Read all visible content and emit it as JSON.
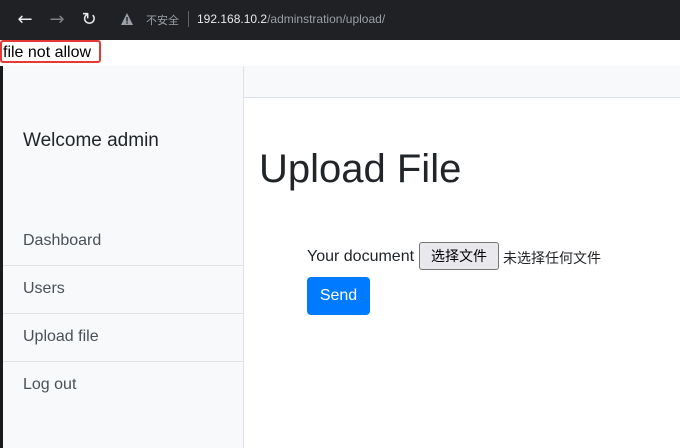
{
  "browser": {
    "insecure_label": "不安全",
    "url_host": "192.168.10.2",
    "url_path": "/adminstration/upload/",
    "icons": [
      "back-arrow-icon",
      "forward-arrow-icon",
      "reload-icon",
      "warning-icon"
    ]
  },
  "error": {
    "message": "file not allow"
  },
  "sidebar": {
    "welcome": "Welcome admin",
    "items": [
      {
        "label": "Dashboard"
      },
      {
        "label": "Users"
      },
      {
        "label": "Upload file"
      },
      {
        "label": "Log out"
      }
    ]
  },
  "main": {
    "title": "Upload File",
    "form": {
      "doc_label": "Your document",
      "file_button": "选择文件",
      "file_status": "未选择任何文件",
      "send_label": "Send"
    }
  },
  "colors": {
    "primary_button": "#007bff",
    "error_border": "#e53935",
    "sidebar_bg": "#f8f9fa",
    "browser_bar": "#202124"
  }
}
